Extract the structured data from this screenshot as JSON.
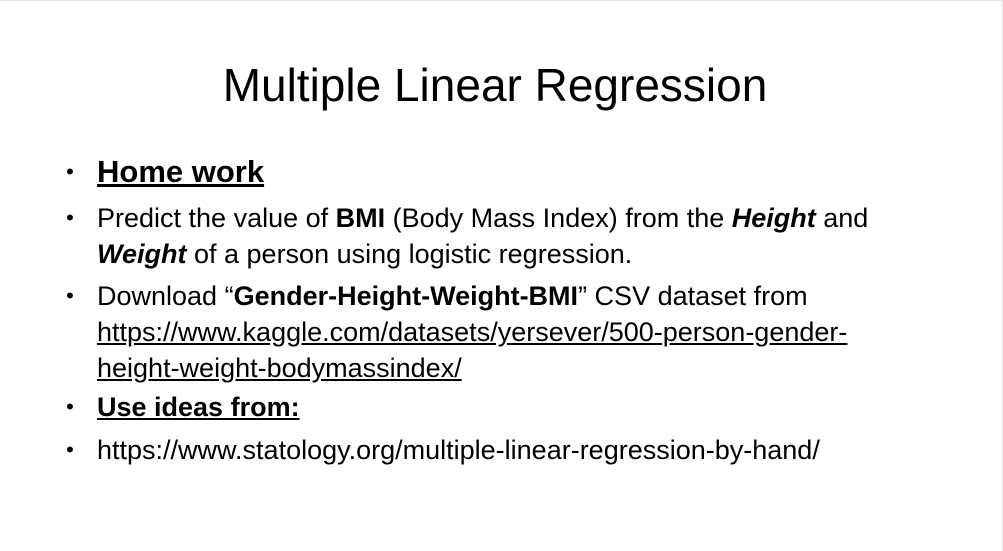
{
  "slide": {
    "title": "Multiple Linear Regression",
    "bullets": {
      "homework": "Home work",
      "predict": {
        "pre": "Predict the value of ",
        "bmi": "BMI",
        "mid1": " (Body Mass Index) from the ",
        "height": "Height",
        "mid2": " and ",
        "weight": "Weight",
        "post": " of a person using logistic regression."
      },
      "download": {
        "pre": "Download “",
        "dataset": "Gender-Height-Weight-BMI",
        "post": "” CSV dataset from",
        "link_line1": "https://www.kaggle.com/datasets/yersever/500-person-gender-",
        "link_line2": "height-weight-bodymassindex/"
      },
      "ideas": "Use ideas from:",
      "statology_url": "https://www.statology.org/multiple-linear-regression-by-hand/"
    }
  }
}
